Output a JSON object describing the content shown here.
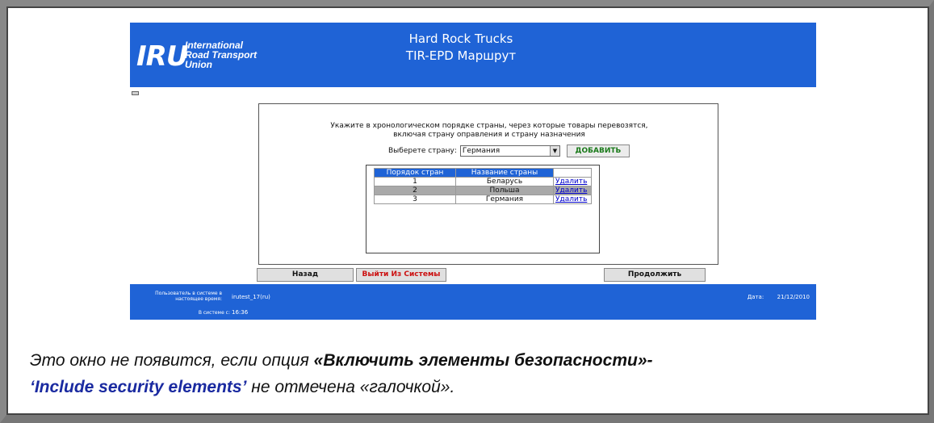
{
  "header": {
    "logo_mark": "IRU",
    "logo_lines": [
      "International",
      "Road Transport",
      "Union"
    ],
    "title_line1": "Hard Rock Trucks",
    "title_line2": "TIR-EPD Маршрут"
  },
  "form": {
    "instruction_line1": "Укажите в хронологическом порядке страны, через которые товары перевозятся,",
    "instruction_line2": "включая страну оправления и страну назначения",
    "select_label": "Выберете страну:",
    "select_value": "Германия",
    "add_button": "ДОБАВИТЬ"
  },
  "table": {
    "headers": [
      "Порядок стран",
      "Название страны"
    ],
    "rows": [
      {
        "order": "1",
        "name": "Беларусь",
        "action": "Удалить"
      },
      {
        "order": "2",
        "name": "Польша",
        "action": "Удалить"
      },
      {
        "order": "3",
        "name": "Германия",
        "action": "Удалить"
      }
    ]
  },
  "buttons": {
    "back": "Назад",
    "logout": "Выйти Из Системы",
    "continue": "Продолжить"
  },
  "footer": {
    "user_label_line1": "Пользователь в системе в",
    "user_label_line2": "настоящее время:",
    "user_value": "irutest_17(ru)",
    "since_label": "В системе с:",
    "since_value": "16:36",
    "date_label": "Дата:",
    "date_value": "21/12/2010"
  },
  "caption": {
    "part1": "Это окно не появится, если опция ",
    "part2": "«Включить элементы безопасности»-",
    "part3": "‘Include security elements’",
    "part4": " не отмечена «галочкой»."
  },
  "colors": {
    "brand_blue": "#1f63d6",
    "add_green": "#1a7a1a",
    "logout_red": "#cc1111",
    "link_blue": "#0000cc",
    "caption_accent": "#1a2aa0"
  }
}
